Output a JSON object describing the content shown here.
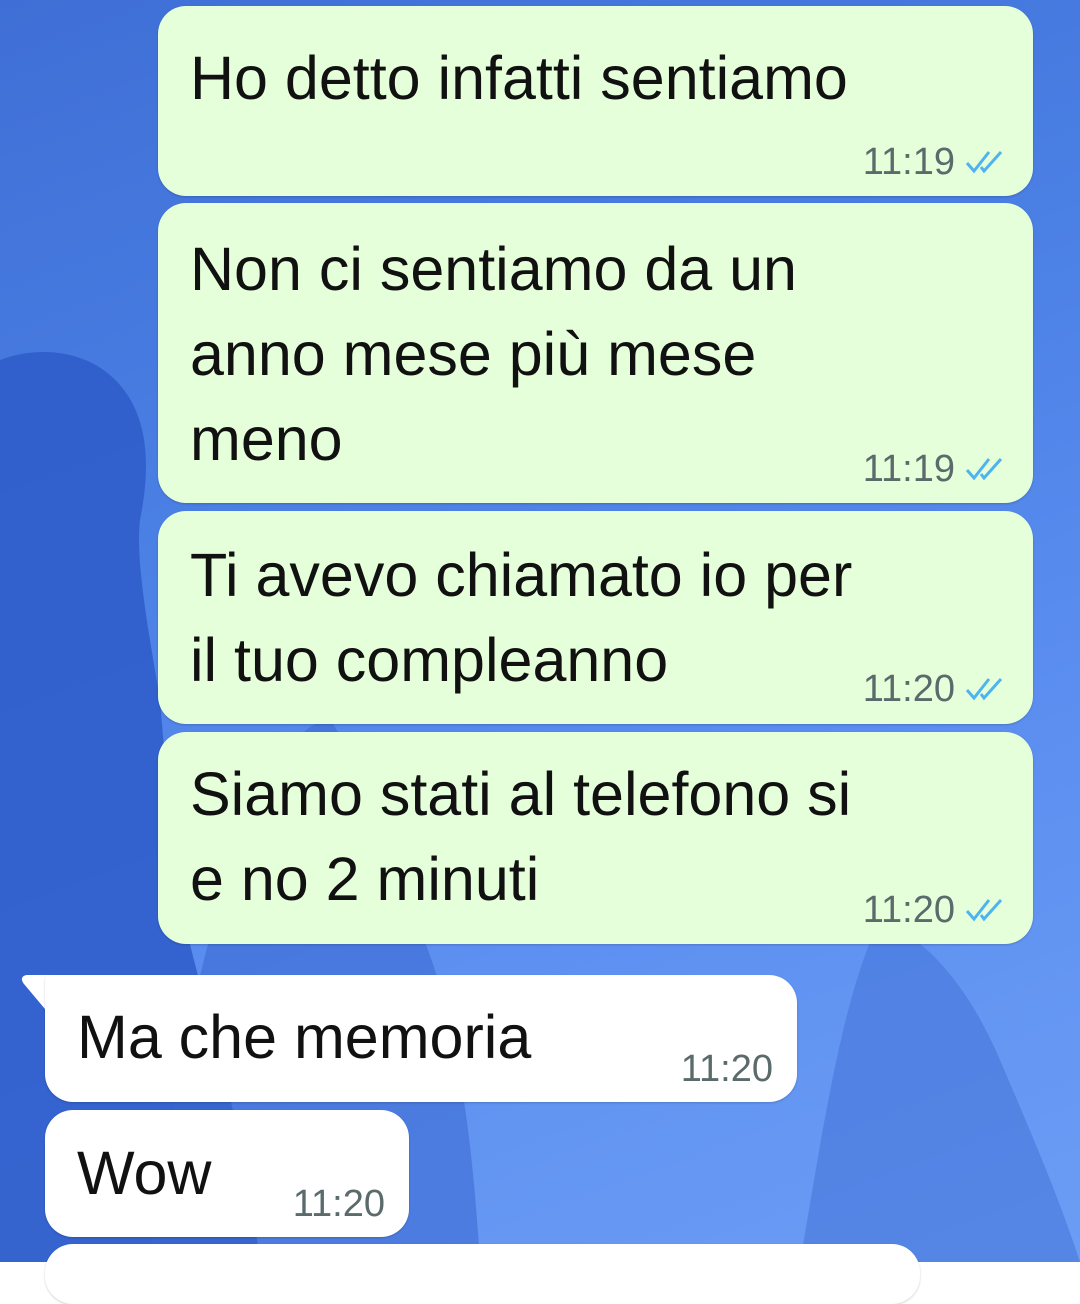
{
  "messages": [
    {
      "direction": "out",
      "lines": [
        "Ho detto infatti sentiamo"
      ],
      "time": "11:19",
      "status": "read-double-check-icon"
    },
    {
      "direction": "out",
      "lines": [
        "Non ci sentiamo da un",
        "anno mese più mese",
        "meno"
      ],
      "time": "11:19",
      "status": "read-double-check-icon"
    },
    {
      "direction": "out",
      "lines": [
        "Ti avevo chiamato io per",
        "il tuo compleanno"
      ],
      "time": "11:20",
      "status": "read-double-check-icon"
    },
    {
      "direction": "out",
      "lines": [
        "Siamo stati al telefono si",
        "e no 2 minuti"
      ],
      "time": "11:20",
      "status": "read-double-check-icon"
    },
    {
      "direction": "in",
      "lines": [
        "Ma che memoria"
      ],
      "time": "11:20"
    },
    {
      "direction": "in",
      "lines": [
        "Wow"
      ],
      "time": "11:20"
    }
  ],
  "colors": {
    "outgoing_bubble": "#e6ffdb",
    "incoming_bubble": "#ffffff",
    "read_tick": "#4fb3f0",
    "wallpaper": "#4a7fe4"
  }
}
